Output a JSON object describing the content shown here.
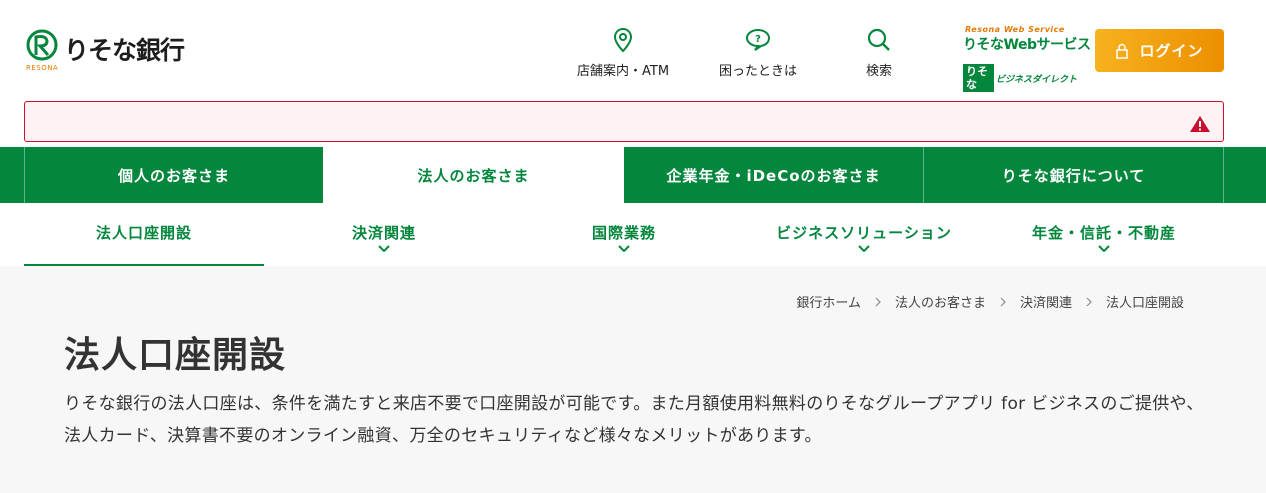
{
  "header": {
    "logo_text": "りそな銀行",
    "logo_sub": "RESONA",
    "util": [
      {
        "label": "店舗案内・ATM",
        "icon": "map-pin-icon"
      },
      {
        "label": "困ったときは",
        "icon": "question-bubble-icon"
      },
      {
        "label": "検索",
        "icon": "search-icon"
      }
    ],
    "web_service": {
      "top": "Resona Web Service",
      "main": "りそなWebサービス",
      "bd_box": "りそな",
      "bd_text": "ビジネスダイレクト"
    },
    "login_label": "ログイン"
  },
  "alert": {
    "icon": "warning-icon"
  },
  "main_nav": [
    {
      "label": "個人のお客さま"
    },
    {
      "label": "法人のお客さま"
    },
    {
      "label": "企業年金・iDeCoのお客さま"
    },
    {
      "label": "りそな銀行について"
    }
  ],
  "sub_nav": [
    {
      "label": "法人口座開設"
    },
    {
      "label": "決済関連"
    },
    {
      "label": "国際業務"
    },
    {
      "label": "ビジネスソリューション"
    },
    {
      "label": "年金・信託・不動産"
    }
  ],
  "breadcrumb": [
    "銀行ホーム",
    "法人のお客さま",
    "決済関連",
    "法人口座開設"
  ],
  "page": {
    "title": "法人口座開設",
    "lead": "りそな銀行の法人口座は、条件を満たすと来店不要で口座開設が可能です。また月額使用料無料のりそなグループアプリ for ビジネスのご提供や、法人カード、決算書不要のオンライン融資、万全のセキュリティなど様々なメリットがあります。"
  },
  "colors": {
    "brand_green": "#04863d",
    "accent_orange": "#ec8f00",
    "alert_red": "#c8102e"
  }
}
